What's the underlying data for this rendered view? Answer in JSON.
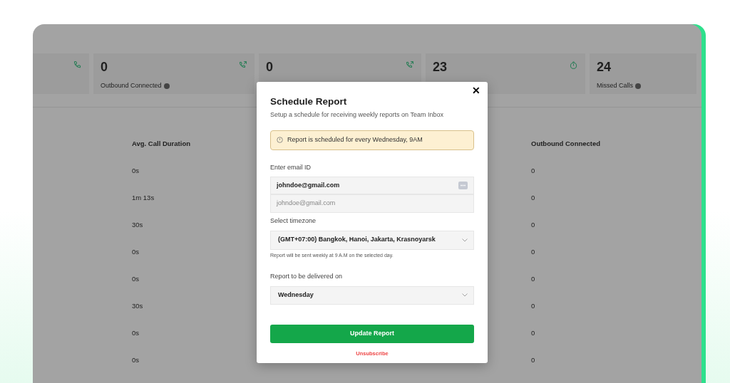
{
  "stats": [
    {
      "kind": "phone"
    },
    {
      "value": "0",
      "label": "Outbound Connected",
      "kind": "outgoing",
      "info": true
    },
    {
      "value": "0",
      "kind": "outgoing"
    },
    {
      "value": "23",
      "kind": "timer"
    },
    {
      "value": "24",
      "label": "Missed Calls",
      "kind": "plain",
      "info": true
    }
  ],
  "table": {
    "columns": [
      "Avg. Call Duration",
      "Outbound Connected"
    ],
    "rows": [
      [
        "0s",
        "0"
      ],
      [
        "1m 13s",
        "0"
      ],
      [
        "30s",
        "0"
      ],
      [
        "0s",
        "0"
      ],
      [
        "0s",
        "0"
      ],
      [
        "30s",
        "0"
      ],
      [
        "0s",
        "0"
      ],
      [
        "0s",
        "0"
      ]
    ]
  },
  "modal": {
    "close": "✕",
    "title": "Schedule Report",
    "subtitle": "Setup a schedule for receiving weekly reports on Team Inbox",
    "alert": "Report is scheduled for every Wednesday, 9AM",
    "email_label": "Enter email ID",
    "email_value": "johndoe@gmail.com",
    "email_suggestion": "johndoe@gmail.com",
    "timezone_label": "Select timezone",
    "timezone_value": "(GMT+07:00) Bangkok, Hanoi, Jakarta, Krasnoyarsk",
    "timezone_help": "Report will be sent weekly at 9 A.M on the selected day.",
    "day_label": "Report to be delivered on",
    "day_value": "Wednesday",
    "submit": "Update Report",
    "unsubscribe": "Unsubscribe"
  }
}
